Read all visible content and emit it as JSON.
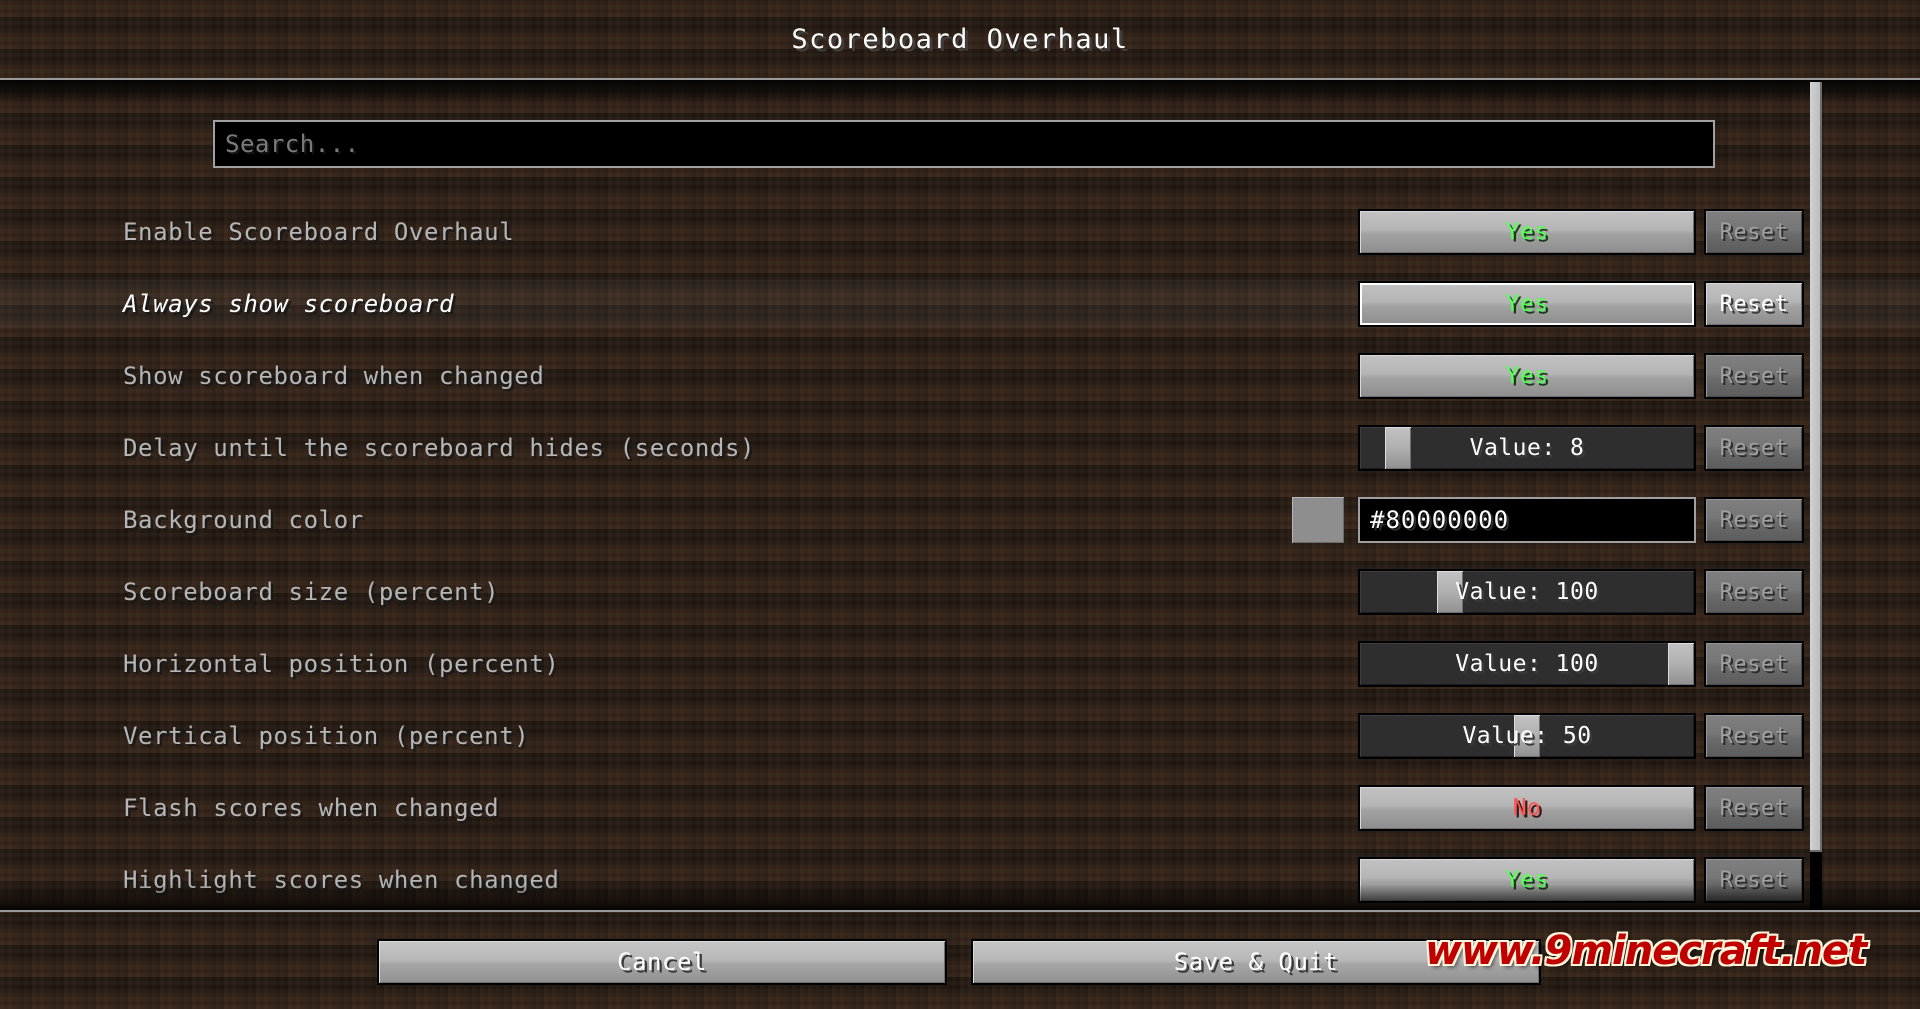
{
  "window": {
    "title": "Scoreboard Overhaul"
  },
  "search": {
    "placeholder": "Search...",
    "value": ""
  },
  "options": [
    {
      "label": "Enable Scoreboard Overhaul",
      "control": "toggle",
      "value": "Yes",
      "value_state": "yes",
      "reset_label": "Reset",
      "reset_enabled": false,
      "hovered": false
    },
    {
      "label": "Always show scoreboard",
      "control": "toggle",
      "value": "Yes",
      "value_state": "yes",
      "reset_label": "Reset",
      "reset_enabled": true,
      "hovered": true
    },
    {
      "label": "Show scoreboard when changed",
      "control": "toggle",
      "value": "Yes",
      "value_state": "yes",
      "reset_label": "Reset",
      "reset_enabled": false,
      "hovered": false
    },
    {
      "label": "Delay until the scoreboard hides (seconds)",
      "control": "slider",
      "value": "Value: 8",
      "slider_percent": 8,
      "reset_label": "Reset",
      "reset_enabled": false,
      "hovered": false
    },
    {
      "label": "Background color",
      "control": "color",
      "value": "#80000000",
      "swatch_color": "#8e8e8e",
      "reset_label": "Reset",
      "reset_enabled": false,
      "hovered": false
    },
    {
      "label": "Scoreboard size (percent)",
      "control": "slider",
      "value": "Value: 100",
      "slider_percent": 25,
      "reset_label": "Reset",
      "reset_enabled": false,
      "hovered": false
    },
    {
      "label": "Horizontal position (percent)",
      "control": "slider",
      "value": "Value: 100",
      "slider_percent": 100,
      "reset_label": "Reset",
      "reset_enabled": false,
      "hovered": false
    },
    {
      "label": "Vertical position (percent)",
      "control": "slider",
      "value": "Value: 50",
      "slider_percent": 50,
      "reset_label": "Reset",
      "reset_enabled": false,
      "hovered": false
    },
    {
      "label": "Flash scores when changed",
      "control": "toggle",
      "value": "No",
      "value_state": "no",
      "reset_label": "Reset",
      "reset_enabled": false,
      "hovered": false
    },
    {
      "label": "Highlight scores when changed",
      "control": "toggle",
      "value": "Yes",
      "value_state": "yes",
      "reset_label": "Reset",
      "reset_enabled": false,
      "hovered": false
    }
  ],
  "footer": {
    "cancel_label": "Cancel",
    "save_label": "Save & Quit"
  },
  "watermark": {
    "text": "www.9minecraft.net"
  },
  "colors": {
    "value_yes": "#55ff55",
    "value_no": "#ff5555",
    "label": "#b6b6b6",
    "label_hovered": "#ffffff",
    "background": "#221a14",
    "watermark": "#c00000"
  }
}
